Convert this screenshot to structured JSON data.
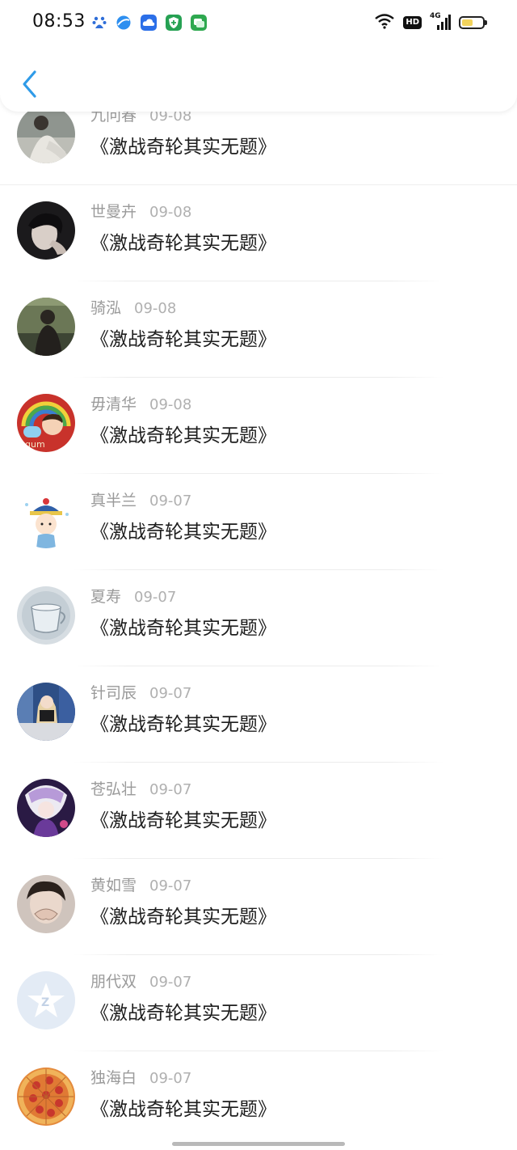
{
  "status_bar": {
    "time": "08:53",
    "hd_label": "HD",
    "network_label": "4G",
    "battery_level": 0.55,
    "notification_icons": [
      "baidu-icon",
      "browser-icon",
      "cloud-icon",
      "shield-app-icon",
      "messages-icon"
    ]
  },
  "nav": {
    "back_icon": "chevron-left-icon",
    "accent": "#2f9be8"
  },
  "comments": [
    {
      "name": "九问春",
      "date": "09-08",
      "text": "《激战奇轮其实无题》",
      "avatar": "photo-woman-sitting"
    },
    {
      "name": "世曼卉",
      "date": "09-08",
      "text": "《激战奇轮其实无题》",
      "avatar": "photo-dark-portrait"
    },
    {
      "name": "骑泓",
      "date": "09-08",
      "text": "《激战奇轮其实无题》",
      "avatar": "photo-person-outdoor"
    },
    {
      "name": "毋清华",
      "date": "09-08",
      "text": "《激战奇轮其实无题》",
      "avatar": "cartoon-boy-rainbow"
    },
    {
      "name": "真半兰",
      "date": "09-07",
      "text": "《激战奇轮其实无题》",
      "avatar": "cartoon-qing-official"
    },
    {
      "name": "夏寿",
      "date": "09-07",
      "text": "《激战奇轮其实无题》",
      "avatar": "glass-teacup"
    },
    {
      "name": "针司辰",
      "date": "09-07",
      "text": "《激战奇轮其实无题》",
      "avatar": "photo-girl-room"
    },
    {
      "name": "苍弘壮",
      "date": "09-07",
      "text": "《激战奇轮其实无题》",
      "avatar": "anime-purple-character"
    },
    {
      "name": "黄如雪",
      "date": "09-07",
      "text": "《激战奇轮其实无题》",
      "avatar": "photo-heart-hands"
    },
    {
      "name": "朋代双",
      "date": "09-07",
      "text": "《激战奇轮其实无题》",
      "avatar": "default-qq-star"
    },
    {
      "name": "独海白",
      "date": "09-07",
      "text": "《激战奇轮其实无题》",
      "avatar": "pizza"
    }
  ]
}
